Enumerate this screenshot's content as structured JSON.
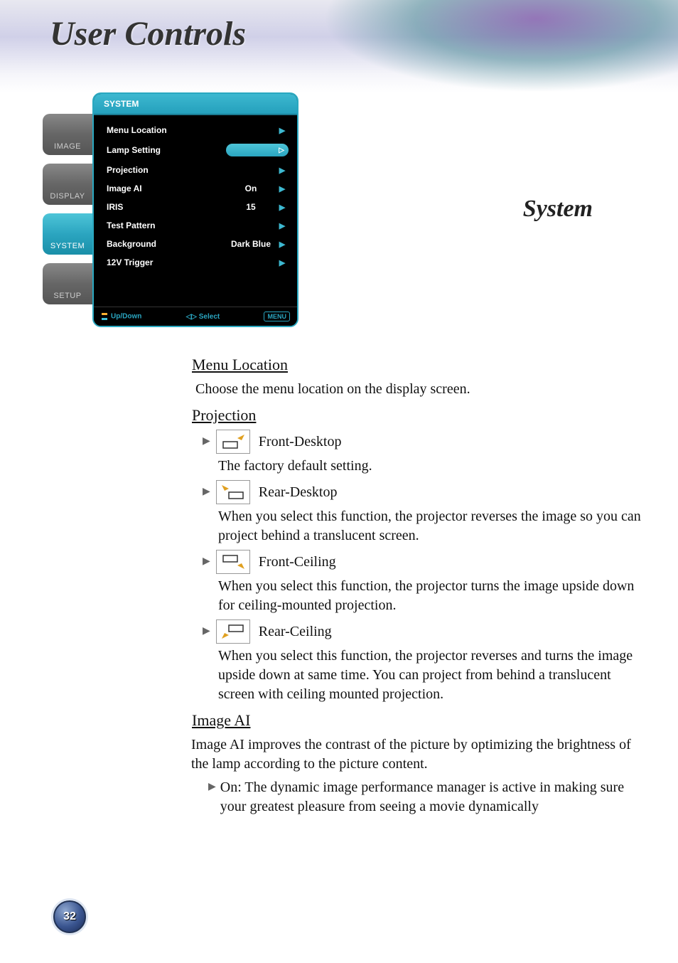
{
  "page_title": "User Controls",
  "section_title": "System",
  "page_number": "32",
  "osd": {
    "tabs": [
      "IMAGE",
      "DISPLAY",
      "SYSTEM",
      "SETUP"
    ],
    "active_tab_index": 2,
    "header": "SYSTEM",
    "rows": [
      {
        "label": "Menu Location",
        "value": ""
      },
      {
        "label": "Lamp Setting",
        "value": "",
        "highlight": true
      },
      {
        "label": "Projection",
        "value": ""
      },
      {
        "label": "Image AI",
        "value": "On"
      },
      {
        "label": "IRIS",
        "value": "15"
      },
      {
        "label": "Test Pattern",
        "value": ""
      },
      {
        "label": "Background",
        "value": "Dark Blue"
      },
      {
        "label": "12V Trigger",
        "value": ""
      }
    ],
    "footer": {
      "updown": "Up/Down",
      "select": "◁▷ Select",
      "menu": "MENU"
    }
  },
  "sections": {
    "menu_location": {
      "heading": "Menu Location",
      "text": "Choose the menu location on the display screen."
    },
    "projection": {
      "heading": "Projection",
      "items": [
        {
          "label": "Front-Desktop",
          "desc": "The factory default setting."
        },
        {
          "label": "Rear-Desktop",
          "desc": "When you select this function, the projector reverses the image so you can project behind a translucent screen."
        },
        {
          "label": "Front-Ceiling",
          "desc": "When you select this function, the projector turns the image upside down for ceiling-mounted projection."
        },
        {
          "label": "Rear-Ceiling",
          "desc": "When you select this function, the projector reverses and turns the image upside down at same time. You can project from behind a translucent screen with ceiling mounted projection."
        }
      ]
    },
    "image_ai": {
      "heading": "Image AI",
      "text": "Image AI improves the contrast of the picture by optimizing the brightness of the lamp according to the picture content.",
      "bullet": "On: The dynamic image performance manager is active in making sure your greatest pleasure from seeing a movie dynamically"
    }
  }
}
